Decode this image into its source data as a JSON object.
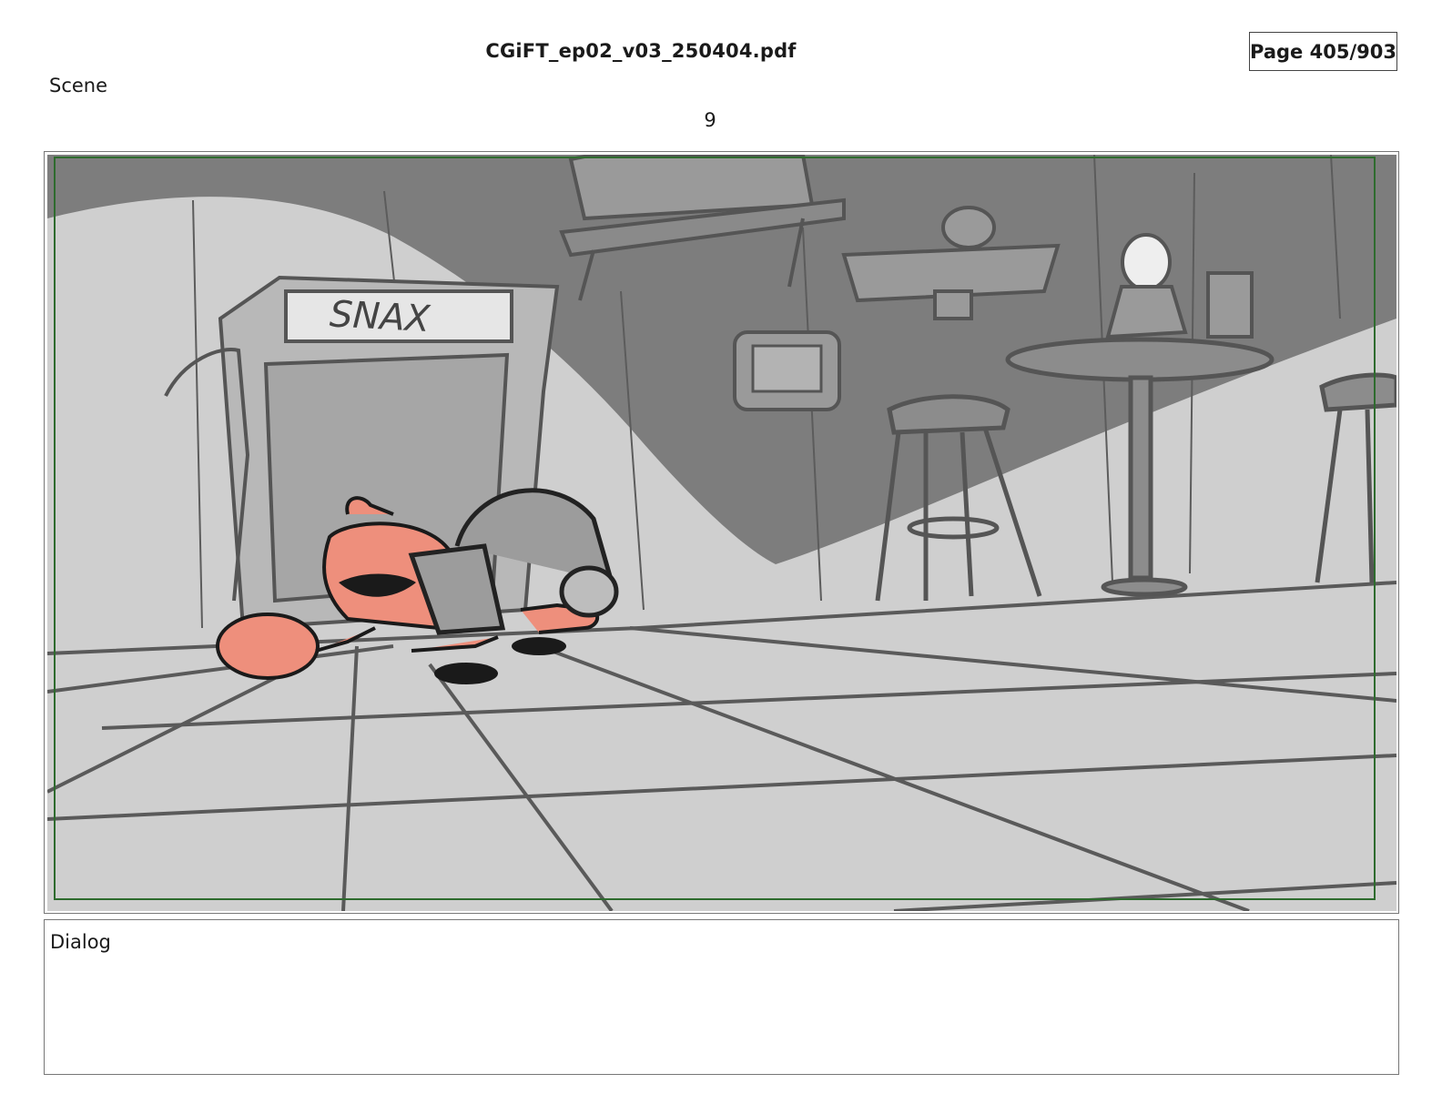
{
  "header": {
    "file_title": "CGiFT_ep02_v03_250404.pdf",
    "page_indicator": "Page 405/903"
  },
  "scene": {
    "label": "Scene",
    "number": "9"
  },
  "panel": {
    "sign_text": "SNAX",
    "safe_frame_color": "#2e6b2e",
    "background_grey": "#cfcfcf",
    "shadow_grey": "#7d7d7d",
    "character_color": "#ee8f7c"
  },
  "dialog": {
    "label": "Dialog",
    "text": ""
  }
}
